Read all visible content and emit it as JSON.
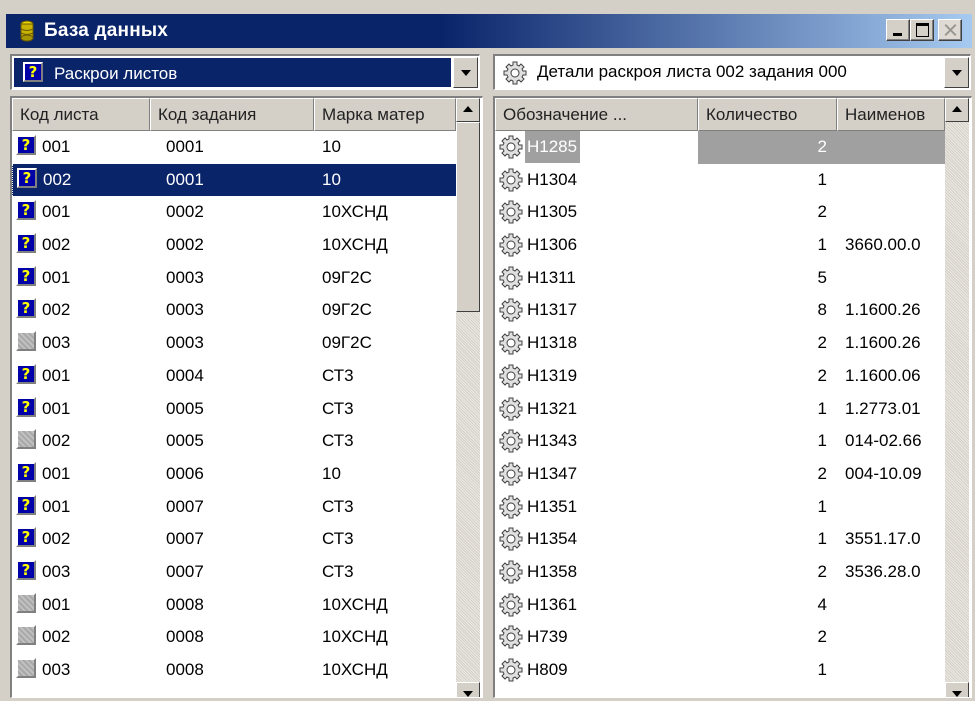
{
  "window": {
    "title": "База данных",
    "icon": "database-icon"
  },
  "left": {
    "combo_label": "Раскрои листов",
    "columns": [
      "Код листа",
      "Код задания",
      "Марка матер"
    ],
    "rows": [
      {
        "code": "001",
        "task": "0001",
        "mat": "10",
        "icon": "question"
      },
      {
        "code": "002",
        "task": "0001",
        "mat": "10",
        "icon": "question",
        "selected": true
      },
      {
        "code": "001",
        "task": "0002",
        "mat": "10ХСНД",
        "icon": "question"
      },
      {
        "code": "002",
        "task": "0002",
        "mat": "10ХСНД",
        "icon": "question"
      },
      {
        "code": "001",
        "task": "0003",
        "mat": "09Г2С",
        "icon": "question"
      },
      {
        "code": "002",
        "task": "0003",
        "mat": "09Г2С",
        "icon": "question"
      },
      {
        "code": "003",
        "task": "0003",
        "mat": "09Г2С",
        "icon": "blank"
      },
      {
        "code": "001",
        "task": "0004",
        "mat": "СТ3",
        "icon": "question"
      },
      {
        "code": "001",
        "task": "0005",
        "mat": "СТ3",
        "icon": "question"
      },
      {
        "code": "002",
        "task": "0005",
        "mat": "СТ3",
        "icon": "blank"
      },
      {
        "code": "001",
        "task": "0006",
        "mat": "10",
        "icon": "question"
      },
      {
        "code": "001",
        "task": "0007",
        "mat": "СТ3",
        "icon": "question"
      },
      {
        "code": "002",
        "task": "0007",
        "mat": "СТ3",
        "icon": "question"
      },
      {
        "code": "003",
        "task": "0007",
        "mat": "СТ3",
        "icon": "question"
      },
      {
        "code": "001",
        "task": "0008",
        "mat": "10ХСНД",
        "icon": "blank"
      },
      {
        "code": "002",
        "task": "0008",
        "mat": "10ХСНД",
        "icon": "blank"
      },
      {
        "code": "003",
        "task": "0008",
        "mat": "10ХСНД",
        "icon": "blank"
      }
    ]
  },
  "right": {
    "combo_label": "Детали раскроя листа 002 задания 000",
    "columns": [
      "Обозначение ...",
      "Количество",
      "Наименов"
    ],
    "rows": [
      {
        "des": "Н1285",
        "qty": "2",
        "name": "",
        "selected": true
      },
      {
        "des": "Н1304",
        "qty": "1",
        "name": ""
      },
      {
        "des": "Н1305",
        "qty": "2",
        "name": ""
      },
      {
        "des": "Н1306",
        "qty": "1",
        "name": "3660.00.0"
      },
      {
        "des": "Н1311",
        "qty": "5",
        "name": ""
      },
      {
        "des": "Н1317",
        "qty": "8",
        "name": "1.1600.26"
      },
      {
        "des": "Н1318",
        "qty": "2",
        "name": "1.1600.26"
      },
      {
        "des": "Н1319",
        "qty": "2",
        "name": "1.1600.06"
      },
      {
        "des": "Н1321",
        "qty": "1",
        "name": "1.2773.01"
      },
      {
        "des": "Н1343",
        "qty": "1",
        "name": "014-02.66"
      },
      {
        "des": "Н1347",
        "qty": "2",
        "name": "004-10.09"
      },
      {
        "des": "Н1351",
        "qty": "1",
        "name": ""
      },
      {
        "des": "Н1354",
        "qty": "1",
        "name": "3551.17.0"
      },
      {
        "des": "Н1358",
        "qty": "2",
        "name": "3536.28.0"
      },
      {
        "des": "Н1361",
        "qty": "4",
        "name": ""
      },
      {
        "des": "Н739",
        "qty": "2",
        "name": ""
      },
      {
        "des": "Н809",
        "qty": "1",
        "name": ""
      }
    ]
  },
  "colors": {
    "title_active": "#0a246a",
    "selection": "#0a246a",
    "face": "#d4d0c8",
    "question_icon_bg": "#0000a8",
    "question_icon_fg": "#ffff00"
  }
}
